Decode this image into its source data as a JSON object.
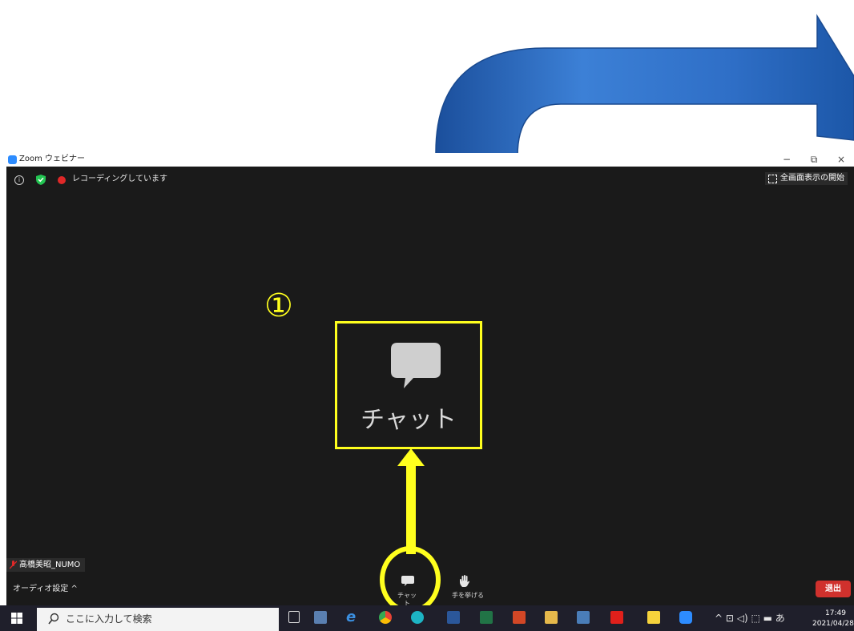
{
  "window": {
    "title": "Zoom ウェビナー",
    "minimize": "−",
    "restore": "⧉",
    "close": "×"
  },
  "meeting": {
    "recording_text": "レコーディングしています",
    "info_glyph": "i",
    "fullscreen_label": "全画面表示の開始"
  },
  "callout": {
    "step_number": "①",
    "zoomed_label": "チャット"
  },
  "toolbar": {
    "participant_name": "髙橋美昭_NUMO",
    "audio_settings": "オーディオ設定 ^",
    "chat_label": "チャット",
    "raise_hand_label": "手を挙げる",
    "exit_label": "退出"
  },
  "taskbar": {
    "search_placeholder": "ここに入力して検索",
    "tray_text": "^   ⊡  ◁)  ⬚  ▬  あ",
    "time": "17:49",
    "date": "2021/04/28"
  },
  "icons": [
    "windows-start-icon",
    "search-icon",
    "task-view-icon",
    "explorer-icon",
    "edge-icon",
    "chrome-icon",
    "edge-new-icon",
    "word-icon",
    "excel-icon",
    "powerpoint-icon",
    "folder-icon",
    "app-icon",
    "acrobat-icon",
    "sticky-notes-icon",
    "zoom-icon"
  ],
  "colors": {
    "highlight": "#ffff1e",
    "arrow_blue": "#2f6fc7",
    "meeting_bg": "#1a1a1a",
    "exit_red": "#d0312d",
    "zoom_blue": "#2d8cff"
  }
}
